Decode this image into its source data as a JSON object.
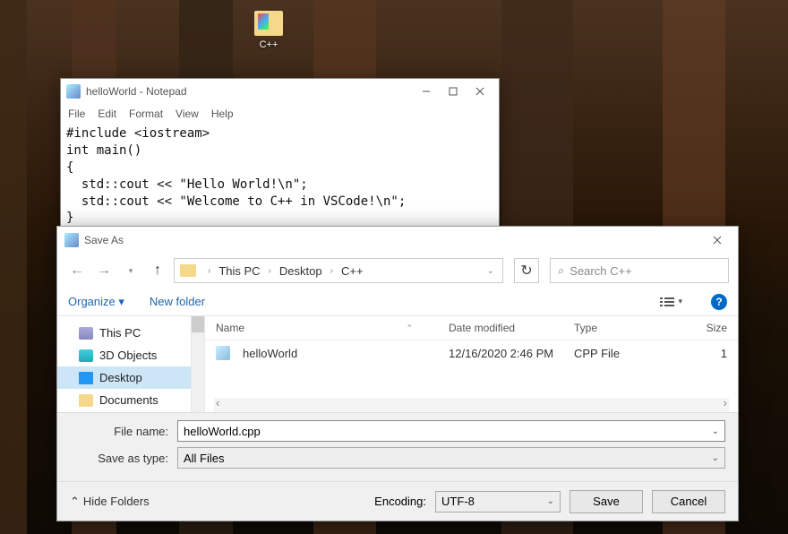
{
  "desktop": {
    "icon_label": "C++"
  },
  "notepad": {
    "title": "helloWorld - Notepad",
    "menus": {
      "file": "File",
      "edit": "Edit",
      "format": "Format",
      "view": "View",
      "help": "Help"
    },
    "content": "#include <iostream>\nint main()\n{\n  std::cout << \"Hello World!\\n\";\n  std::cout << \"Welcome to C++ in VSCode!\\n\";\n}"
  },
  "saveas": {
    "title": "Save As",
    "breadcrumb": {
      "root": "This PC",
      "p1": "Desktop",
      "p2": "C++"
    },
    "search_placeholder": "Search C++",
    "toolbar": {
      "organize": "Organize",
      "newfolder": "New folder"
    },
    "columns": {
      "name": "Name",
      "date": "Date modified",
      "type": "Type",
      "size": "Size"
    },
    "sidebar": {
      "items": [
        {
          "label": "This PC"
        },
        {
          "label": "3D Objects"
        },
        {
          "label": "Desktop"
        },
        {
          "label": "Documents"
        }
      ]
    },
    "files": [
      {
        "name": "helloWorld",
        "date": "12/16/2020 2:46 PM",
        "type": "CPP File",
        "size": "1"
      }
    ],
    "filename_label": "File name:",
    "filename_value": "helloWorld.cpp",
    "savetype_label": "Save as type:",
    "savetype_value": "All Files",
    "hide_folders": "Hide Folders",
    "encoding_label": "Encoding:",
    "encoding_value": "UTF-8",
    "save": "Save",
    "cancel": "Cancel"
  }
}
